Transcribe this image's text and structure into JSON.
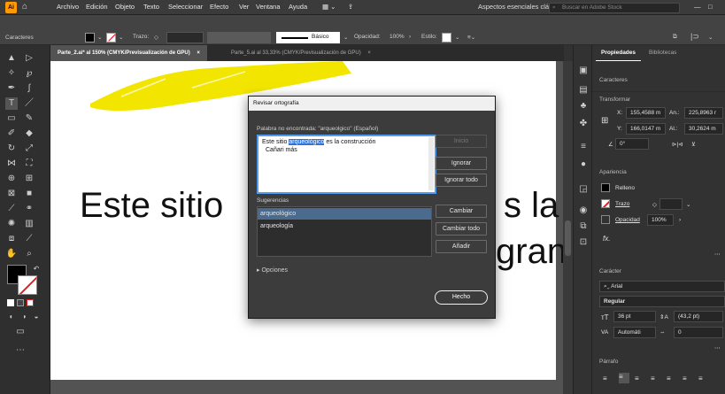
{
  "menubar": {
    "items": [
      "Archivo",
      "Edición",
      "Objeto",
      "Texto",
      "Seleccionar",
      "Efecto",
      "Ver",
      "Ventana",
      "Ayuda"
    ],
    "workspace": "Aspectos esenciales clásicos",
    "stock_placeholder": "Buscar en Adobe Stock"
  },
  "controlbar": {
    "panel_label": "Caracteres",
    "stroke_label": "Trazo:",
    "basic_label": "Básico",
    "opacity_label": "Opacidad:",
    "opacity_value": "100%",
    "style_label": "Estilo:"
  },
  "tabs": [
    {
      "label": "Parte_2.ai* al 150% (CMYK/Previsualización de GPU)",
      "close": "×"
    },
    {
      "label": "Parte_5.ai al 33,33% (CMYK/Previsualización de GPU)",
      "close": "×"
    }
  ],
  "artboard": {
    "text_line1_left": "Este sitio",
    "text_line1_right": "s la",
    "text_line2_right": "gran"
  },
  "dialog": {
    "title": "Revisar ortografía",
    "not_found_label": "Palabra no encontrada: \"arqueolgico\" (Español)",
    "text_before": "Este sitio ",
    "text_highlight": "arqueológico",
    "text_after": " es la construcción",
    "text_line2": "Cañari más",
    "btn_start": "Inicio",
    "btn_ignore": "Ignorar",
    "btn_ignore_all": "Ignorar todo",
    "suggestions_label": "Sugerencias",
    "suggestions": [
      "arqueológico",
      "arqueología"
    ],
    "btn_change": "Cambiar",
    "btn_change_all": "Cambiar todo",
    "btn_add": "Añadir",
    "options_label": "Opciones",
    "btn_done": "Hecho"
  },
  "panel": {
    "tab_properties": "Propiedades",
    "tab_libraries": "Bibliotecas",
    "section_characters": "Caracteres",
    "section_transform": "Transformar",
    "x_label": "X:",
    "x_value": "155,4588 m",
    "w_label": "An.:",
    "w_value": "225,8963 r",
    "y_label": "Y:",
    "y_value": "166,0147 m",
    "h_label": "Al.:",
    "h_value": "30,2624 m",
    "angle_value": "0°",
    "section_appearance": "Apariencia",
    "fill_label": "Relleno",
    "stroke_label": "Trazo",
    "opacity_label": "Opacidad",
    "opacity_value": "100%",
    "fx_label": "fx.",
    "section_character": "Carácter",
    "font_family": "Arial",
    "font_style": "Regular",
    "font_size": "36 pt",
    "leading": "(43,2 pt)",
    "kerning": "Automáti",
    "tracking": "0",
    "section_paragraph": "Párrafo"
  },
  "colors": {
    "accent": "#2f73d8",
    "yellow_brush": "#f2e600",
    "app_bg": "#323232"
  }
}
